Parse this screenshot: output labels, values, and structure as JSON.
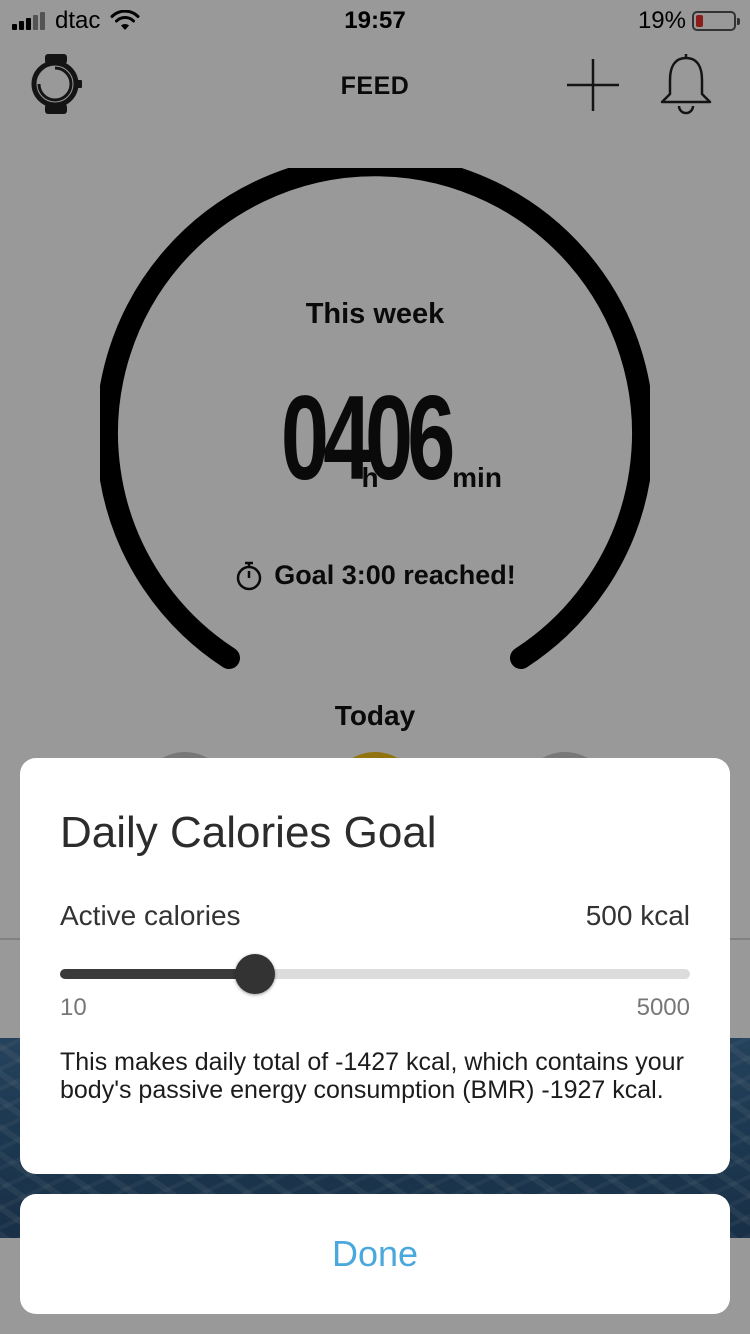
{
  "status_bar": {
    "carrier": "dtac",
    "time": "19:57",
    "battery_percent_label": "19%",
    "battery_level": 0.19,
    "signal_bars_filled": 3,
    "signal_bars_total": 5
  },
  "nav": {
    "title": "FEED",
    "watch_icon": "watch-icon",
    "add_icon": "plus-icon",
    "notifications_icon": "bell-icon"
  },
  "summary": {
    "period_label": "This week",
    "hours": "04",
    "hours_unit": "h",
    "minutes": "06",
    "minutes_unit": "min",
    "goal_text": "Goal 3:00 reached!",
    "goal_icon": "stopwatch-icon"
  },
  "today": {
    "label": "Today"
  },
  "dialog": {
    "title": "Daily Calories Goal",
    "setting_label": "Active calories",
    "setting_value": "500 kcal",
    "slider": {
      "min_label": "10",
      "max_label": "5000",
      "position_fraction": 0.31
    },
    "note": "This makes daily total of -1427 kcal, which contains your body's passive energy consumption (BMR) -1927 kcal."
  },
  "done_button": {
    "label": "Done"
  },
  "colors": {
    "accent": "#4aa8dc",
    "battery_low": "#e8302a",
    "ring": "#000000",
    "scrim": "rgba(0,0,0,0.40)"
  }
}
